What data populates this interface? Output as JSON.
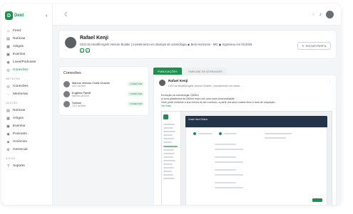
{
  "brand": {
    "logo_letter": "D",
    "name": "Dent"
  },
  "sidebar": {
    "sections": [
      {
        "label": "",
        "items": [
          {
            "label": "Feed",
            "icon": "home-icon",
            "icon_char": "⌂"
          },
          {
            "label": "Notícias",
            "icon": "news-icon",
            "icon_char": "▤"
          },
          {
            "label": "Artigos",
            "icon": "article-icon",
            "icon_char": "▦"
          },
          {
            "label": "Eventos",
            "icon": "calendar-icon",
            "icon_char": "▣"
          },
          {
            "label": "Lives/Podcasts",
            "icon": "mic-icon",
            "icon_char": "◉"
          },
          {
            "label": "Conexões",
            "icon": "users-icon",
            "icon_char": "◎",
            "active": true
          }
        ]
      },
      {
        "label": "NETWORK",
        "items": [
          {
            "label": "Conexões",
            "icon": "users-icon",
            "icon_char": "◎"
          },
          {
            "label": "Mentorias",
            "icon": "chat-icon",
            "icon_char": "◌"
          }
        ]
      },
      {
        "label": "GESTÃO",
        "items": [
          {
            "label": "Notícias",
            "icon": "news-icon",
            "icon_char": "▤"
          },
          {
            "label": "Artigos",
            "icon": "article-icon",
            "icon_char": "▦"
          },
          {
            "label": "Eventos",
            "icon": "calendar-icon",
            "icon_char": "▣"
          },
          {
            "label": "Podcasts",
            "icon": "mic-icon",
            "icon_char": "◉"
          },
          {
            "label": "Anúncios",
            "icon": "megaphone-icon",
            "icon_char": "◈"
          },
          {
            "label": "Gerencial",
            "icon": "settings-icon",
            "icon_char": "⚙"
          }
        ]
      },
      {
        "label": "AJUDA",
        "items": [
          {
            "label": "Suporte",
            "icon": "help-icon",
            "icon_char": "?"
          }
        ]
      }
    ]
  },
  "profile": {
    "name": "Rafael Kenji",
    "bio": "CEO do HealthAngels Venture Builder | Investimento em startups de odontologia  ◉ Belo Horizonte - MG  ▣ Ingressou em 01/2025",
    "edit_label": "EDITAR PERFIL"
  },
  "connections": {
    "title": "Conexões",
    "items": [
      {
        "name": "Marcus Vinicius Costa Chaves",
        "role": "CEO da Dent",
        "action": "CONECTAR"
      },
      {
        "name": "Eugênio Parelli",
        "role": "Membro da Dent",
        "action": "CONECTAR"
      },
      {
        "name": "Samuel",
        "role": "CEO da Dent",
        "action": "CONECTAR"
      }
    ]
  },
  "tabs": [
    {
      "label": "PUBLICAÇÕES",
      "active": true
    },
    {
      "label": "TIMELINE DE ATIVIDADES",
      "active": false
    }
  ],
  "post": {
    "author": "Rafael Kenji",
    "subtitle": "CEO do HealthAngels Venture Builder | Investimento em startu...",
    "line1": "Evolução na odontologia: QiDent",
    "line2": "A nova plataforma da QiDent está com uma nova funcionalidade...",
    "line3": "Você pode construir a sua clínica do seu conforto, a partir dos seus custos fixos e taxa de ocupação...",
    "more": "Ver mais",
    "screenshot_title": "Custo Hora Clínica"
  }
}
